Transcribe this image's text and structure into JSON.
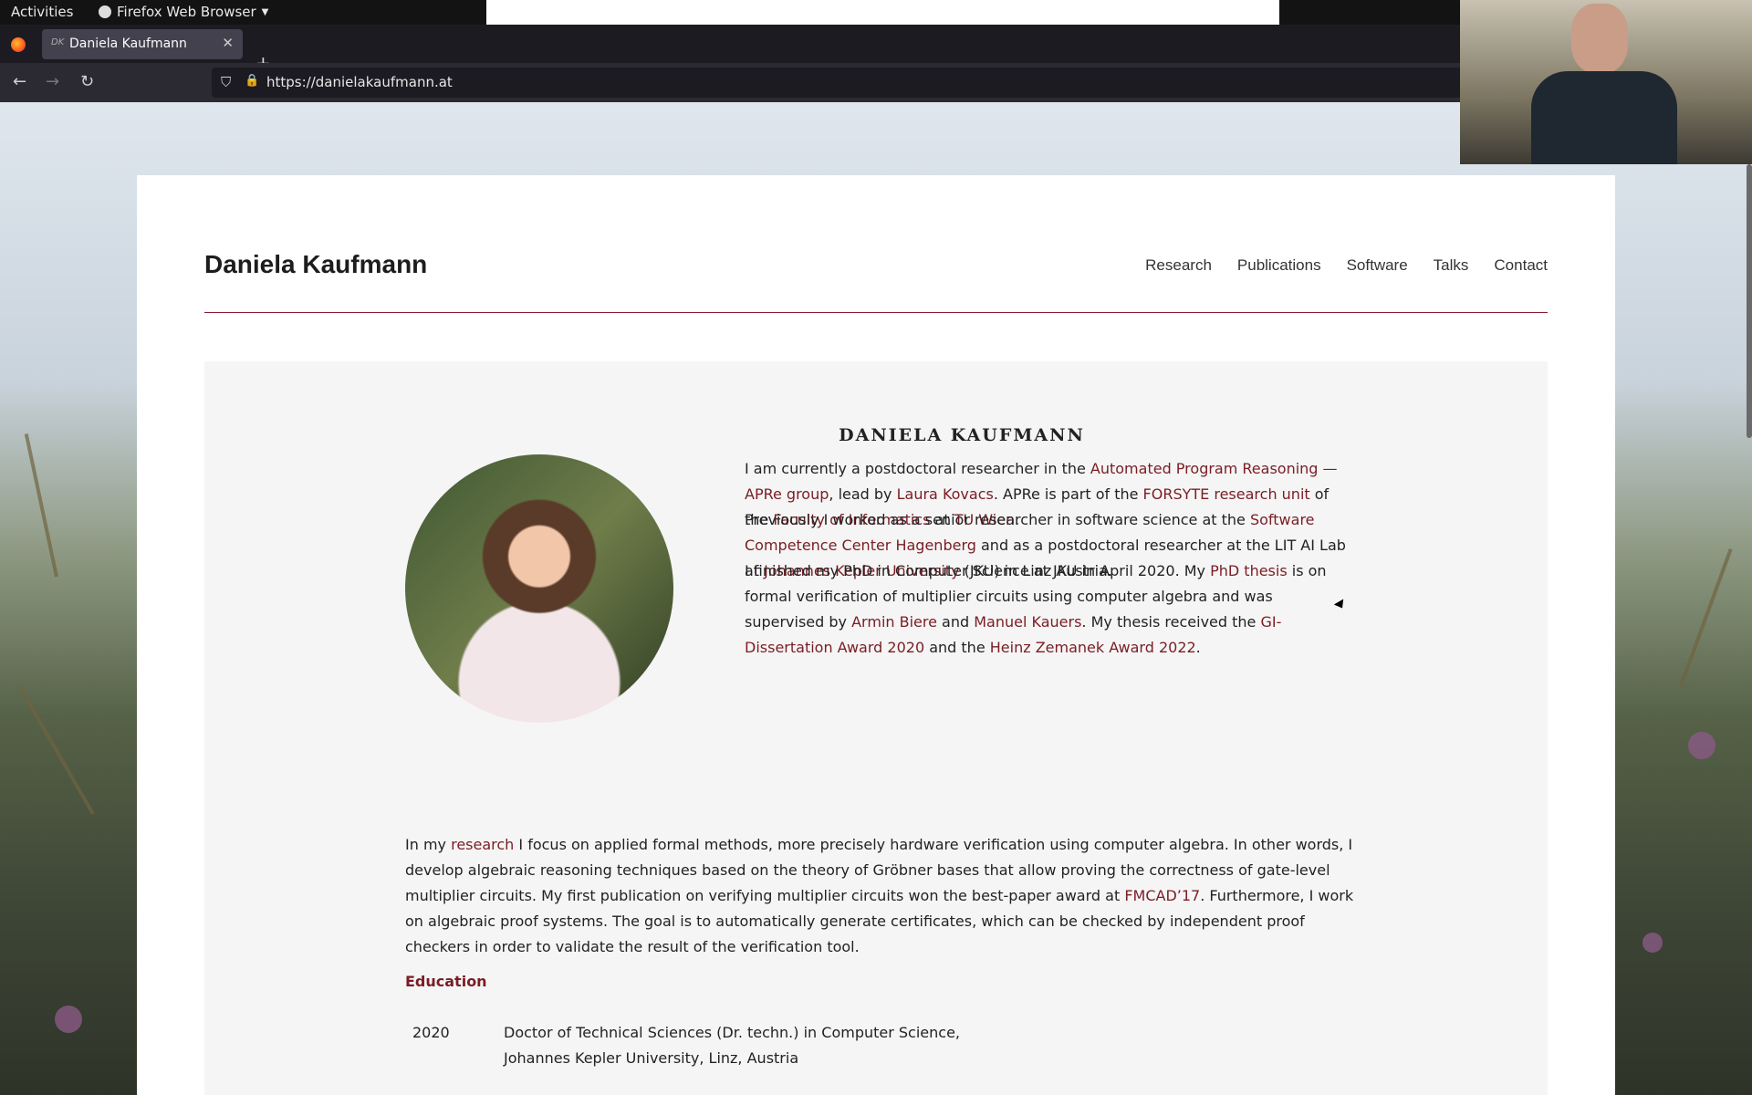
{
  "os": {
    "activities": "Activities",
    "app_menu": "Firefox Web Browser"
  },
  "browser": {
    "tab_favicon": "DK",
    "tab_title": "Daniela Kaufmann",
    "url": "https://danielakaufmann.at"
  },
  "site": {
    "title": "Daniela Kaufmann",
    "nav": [
      "Research",
      "Publications",
      "Software",
      "Talks",
      "Contact"
    ]
  },
  "intro": {
    "heading": "DANIELA KAUFMANN",
    "p1": {
      "t1": "I am currently a postdoctoral researcher in the ",
      "l1": "Automated Program Reasoning — APRe group",
      "t2": ", lead by ",
      "l2": "Laura Kovacs",
      "t3": ". APRe is part of the ",
      "l3": "FORSYTE research unit",
      "t4": " of the ",
      "l4": "Faculty of Informatics",
      "t5": " at ",
      "l5": "TU Wien",
      "t6": "."
    },
    "p2": {
      "t1": "Previously I worked as a senior researcher in software science at the ",
      "l1": "Software Competence Center Hagenberg",
      "t2": " and as a postdoctoral researcher at the LIT AI Lab at ",
      "l2": "Johannes Kepler University",
      "t3": " (JKU) in Linz Austria."
    },
    "p3": {
      "t1": "I finished my PhD in Computer Science at JKU in April 2020. My ",
      "l1": "PhD thesis",
      "t2": " is on formal verification of multiplier circuits using computer algebra and was supervised by ",
      "l2": "Armin Biere",
      "t3": " and ",
      "l3": "Manuel Kauers",
      "t4": ". My thesis received the ",
      "l4": "GI-Dissertation Award 2020",
      "t5": " and the ",
      "l5": "Heinz Zemanek Award 2022",
      "t6": "."
    },
    "p4": {
      "t1": "In my ",
      "l1": "research",
      "t2": " I focus on applied formal methods, more precisely hardware verification using computer algebra. In other words, I develop algebraic reasoning techniques based on the theory of Gröbner bases that allow proving the correctness of gate-level multiplier circuits. My first publication on verifying multiplier circuits won the best-paper award at ",
      "l2": "FMCAD’17",
      "t3": ". Furthermore, I work on algebraic proof systems. The goal is to automatically generate certificates, which can be checked by independent proof checkers in order to validate the result of the verification tool."
    }
  },
  "education": {
    "heading": "Education",
    "rows": [
      {
        "year": "2020",
        "line1": "Doctor of Technical Sciences (Dr. techn.) in Computer Science,",
        "line2": "Johannes Kepler University, Linz, Austria"
      }
    ]
  },
  "colors": {
    "link": "#7a1d24",
    "rule": "#8b1a2b"
  }
}
